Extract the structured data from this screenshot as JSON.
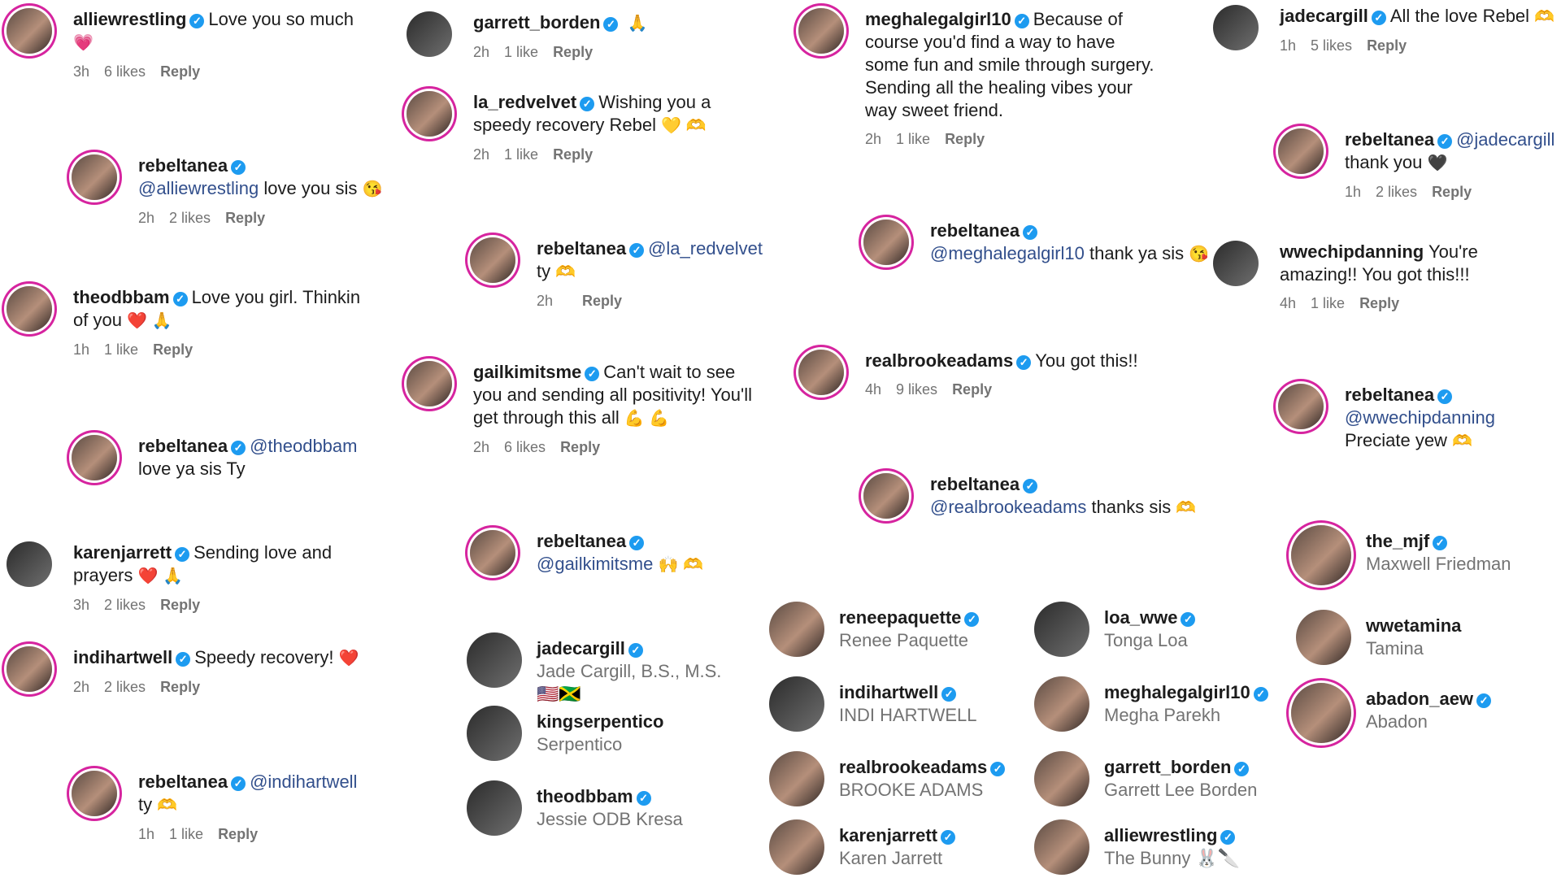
{
  "labels": {
    "reply": "Reply",
    "verified": "✓"
  },
  "comments": [
    {
      "user": "alliewrestling",
      "text": "Love you so much",
      "emoji": "💗",
      "time": "3h",
      "likes": "6 likes"
    },
    {
      "user": "rebeltanea",
      "mention": "@alliewrestling",
      "text": "love you sis",
      "emoji": "😘",
      "time": "2h",
      "likes": "2 likes"
    },
    {
      "user": "theodbbam",
      "text": "Love you girl. Thinkin of you",
      "emoji": "❤️ 🙏",
      "time": "1h",
      "likes": "1 like"
    },
    {
      "user": "rebeltanea",
      "mention": "@theodbbam",
      "text": "love ya sis Ty",
      "emoji": "",
      "time": "",
      "likes": ""
    },
    {
      "user": "karenjarrett",
      "text": "Sending love and prayers",
      "emoji": "❤️ 🙏",
      "time": "3h",
      "likes": "2 likes"
    },
    {
      "user": "indihartwell",
      "text": "Speedy recovery!",
      "emoji": "❤️",
      "time": "2h",
      "likes": "2 likes"
    },
    {
      "user": "rebeltanea",
      "mention": "@indihartwell",
      "text": "ty",
      "emoji": "🫶",
      "time": "1h",
      "likes": "1 like"
    },
    {
      "user": "garrett_borden",
      "text": "",
      "emoji": "🙏",
      "time": "2h",
      "likes": "1 like"
    },
    {
      "user": "la_redvelvet",
      "text": "Wishing you a speedy recovery Rebel",
      "emoji": "💛 🫶",
      "time": "2h",
      "likes": "1 like"
    },
    {
      "user": "rebeltanea",
      "mention": "@la_redvelvet",
      "text": "ty",
      "emoji": "🫶",
      "time": "2h",
      "likes": ""
    },
    {
      "user": "gailkimitsme",
      "text": "Can't wait to see you and sending all positivity! You'll get through this all",
      "emoji": "💪 💪",
      "time": "2h",
      "likes": "6 likes"
    },
    {
      "user": "rebeltanea",
      "mention": "@gailkimitsme",
      "text": "",
      "emoji": "🙌 🫶",
      "time": "",
      "likes": ""
    },
    {
      "user": "meghalegalgirl10",
      "text": "Because of course you'd find a way to have some fun and smile through surgery. Sending all the healing vibes your way sweet friend.",
      "emoji": "",
      "time": "2h",
      "likes": "1 like"
    },
    {
      "user": "rebeltanea",
      "mention": "@meghalegalgirl10",
      "text": "thank ya sis",
      "emoji": "😘",
      "time": "",
      "likes": ""
    },
    {
      "user": "realbrookeadams",
      "text": "You got this!!",
      "emoji": "",
      "time": "4h",
      "likes": "9 likes"
    },
    {
      "user": "rebeltanea",
      "mention": "@realbrookeadams",
      "text": "thanks sis",
      "emoji": "🫶",
      "time": "",
      "likes": ""
    },
    {
      "user": "jadecargill",
      "text": "All the love Rebel",
      "emoji": "🫶",
      "time": "1h",
      "likes": "5 likes"
    },
    {
      "user": "rebeltanea",
      "mention": "@jadecargill",
      "text": "thank you",
      "emoji": "🖤",
      "time": "1h",
      "likes": "2 likes"
    },
    {
      "user": "wwechipdanning",
      "text": "You're amazing!! You got this!!!",
      "emoji": "",
      "time": "4h",
      "likes": "1 like"
    },
    {
      "user": "rebeltanea",
      "mention": "@wwechipdanning",
      "text": "Preciate yew",
      "emoji": "🫶",
      "time": "",
      "likes": ""
    }
  ],
  "accounts": [
    {
      "user": "jadecargill",
      "name": "Jade Cargill, B.S., M.S. 🇺🇸🇯🇲"
    },
    {
      "user": "kingserpentico",
      "name": "Serpentico"
    },
    {
      "user": "theodbbam",
      "name": "Jessie ODB Kresa"
    },
    {
      "user": "reneepaquette",
      "name": "Renee Paquette"
    },
    {
      "user": "indihartwell",
      "name": "INDI HARTWELL"
    },
    {
      "user": "realbrookeadams",
      "name": "BROOKE ADAMS"
    },
    {
      "user": "karenjarrett",
      "name": "Karen Jarrett"
    },
    {
      "user": "loa_wwe",
      "name": "Tonga Loa"
    },
    {
      "user": "meghalegalgirl10",
      "name": "Megha Parekh"
    },
    {
      "user": "garrett_borden",
      "name": "Garrett Lee Borden"
    },
    {
      "user": "alliewrestling",
      "name": "The Bunny 🐰🔪"
    },
    {
      "user": "the_mjf",
      "name": "Maxwell Friedman"
    },
    {
      "user": "wwetamina",
      "name": "Tamina"
    },
    {
      "user": "abadon_aew",
      "name": "Abadon"
    }
  ]
}
